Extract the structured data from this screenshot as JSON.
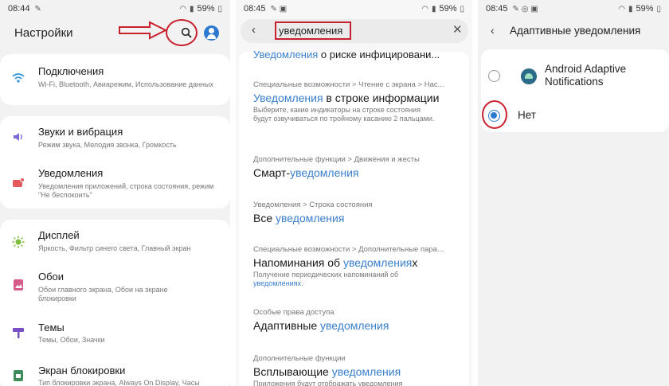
{
  "screen1": {
    "status": {
      "time": "08:44",
      "battery": "59%"
    },
    "title": "Настройки",
    "items": [
      {
        "icon": "wifi-icon",
        "title": "Подключения",
        "subtitle": "Wi-Fi, Bluetooth, Авиарежим, Использование данных"
      },
      {
        "icon": "volume-icon",
        "title": "Звуки и вибрация",
        "subtitle": "Режим звука, Мелодия звонка, Громкость"
      },
      {
        "icon": "notifications-icon",
        "title": "Уведомления",
        "subtitle": "Уведомления приложений, строка состояния, режим \"Не беспокоить\""
      },
      {
        "icon": "brightness-icon",
        "title": "Дисплей",
        "subtitle": "Яркость, Фильтр синего света, Главный экран"
      },
      {
        "icon": "wallpaper-icon",
        "title": "Обои",
        "subtitle": "Обои главного экрана, Обои на экране блокировки"
      },
      {
        "icon": "themes-icon",
        "title": "Темы",
        "subtitle": "Темы, Обои, Значки"
      },
      {
        "icon": "lock-screen-icon",
        "title": "Экран блокировки",
        "subtitle": "Тип блокировки экрана, Always On Display, Часы"
      }
    ]
  },
  "screen2": {
    "status": {
      "time": "08:45",
      "battery": "59%"
    },
    "query": "уведомления",
    "top_partial": {
      "hl": "Уведомления",
      "rest": " о риске инфицировани..."
    },
    "results": [
      {
        "path": "Специальные возможности > Чтение с экрана > Нас...",
        "pre": "",
        "hl": "Уведомления",
        "post": " в строке информации",
        "desc_pre": "Выберите, какие индикаторы на строке состояния будут озвучиваться по тройному касанию 2 пальцами.",
        "desc_hl": "",
        "desc_post": ""
      },
      {
        "path": "Дополнительные функции > Движения и жесты",
        "pre": "Смарт-",
        "hl": "уведомления",
        "post": "",
        "desc_pre": "",
        "desc_hl": "",
        "desc_post": ""
      },
      {
        "path": "Уведомления > Строка состояния",
        "pre": "Все ",
        "hl": "уведомления",
        "post": "",
        "desc_pre": "",
        "desc_hl": "",
        "desc_post": ""
      },
      {
        "path": "Специальные возможности > Дополнительные пара...",
        "pre": "Напоминания об ",
        "hl": "уведомления",
        "post": "х",
        "desc_pre": "Получение периодических напоминаний об ",
        "desc_hl": "уведомлениях",
        "desc_post": "."
      },
      {
        "path": "Особые права доступа",
        "pre": "Адаптивные ",
        "hl": "уведомления",
        "post": "",
        "desc_pre": "",
        "desc_hl": "",
        "desc_post": ""
      },
      {
        "path": "Дополнительные функции",
        "pre": "Всплывающие ",
        "hl": "уведомления",
        "post": "",
        "desc_pre": "Приложения будут отображать уведомления",
        "desc_hl": "",
        "desc_post": ""
      }
    ]
  },
  "screen3": {
    "status": {
      "time": "08:45",
      "battery": "59%"
    },
    "title": "Адаптивные уведомления",
    "options": [
      {
        "label": "Android Adaptive Notifications",
        "selected": false
      },
      {
        "label": "Нет",
        "selected": true
      }
    ]
  },
  "colors": {
    "highlight": "#3a7fcc",
    "annotation": "#c9202e",
    "accent": "#2e79d0"
  }
}
